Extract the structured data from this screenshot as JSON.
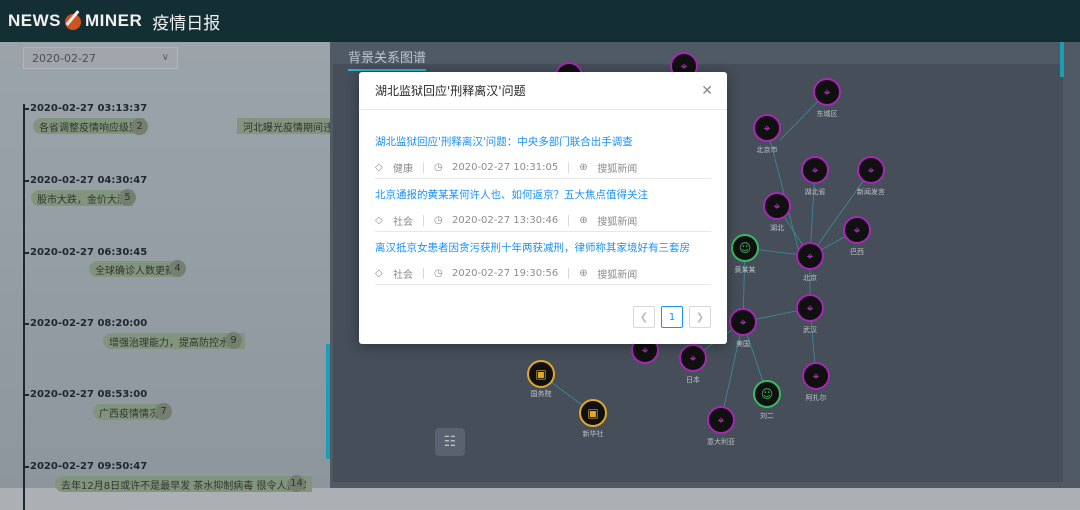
{
  "header": {
    "brand_left": "NEWS",
    "brand_right": "MINER",
    "app_title": "疫情日报"
  },
  "filter": {
    "date_value": "2020-02-27"
  },
  "graph": {
    "title": "背景关系图谱",
    "nodes": [
      {
        "label": "东城区",
        "type": "place"
      },
      {
        "label": "北京市",
        "type": "place"
      },
      {
        "label": "湖北省",
        "type": "place"
      },
      {
        "label": "新闻发言",
        "type": "place"
      },
      {
        "label": "湖北",
        "type": "place"
      },
      {
        "label": "巴西",
        "type": "place"
      },
      {
        "label": "黄某某",
        "type": "person"
      },
      {
        "label": "北京",
        "type": "place"
      },
      {
        "label": "武汉",
        "type": "place"
      },
      {
        "label": "美国",
        "type": "place"
      },
      {
        "label": "日本",
        "type": "place"
      },
      {
        "label": "刘二",
        "type": "person"
      },
      {
        "label": "阿扎尔",
        "type": "place"
      },
      {
        "label": "意大利亚",
        "type": "place"
      },
      {
        "label": "国务院",
        "type": "org"
      },
      {
        "label": "新华社",
        "type": "org"
      }
    ]
  },
  "timeline": [
    {
      "time": "2020-02-27 03:13:37",
      "tag": "各省调整疫情响应级别",
      "count": "2"
    },
    {
      "time": "2020-02-27 04:30:47",
      "tag": "股市大跌，金价大涨",
      "count": "5"
    },
    {
      "time": "2020-02-27 06:30:45",
      "tag": "全球确诊人数更新",
      "count": "4"
    },
    {
      "time": "2020-02-27 08:20:00",
      "tag": "增强治理能力，提高防控水平",
      "count": "9"
    },
    {
      "time": "2020-02-27 08:53:00",
      "tag": "广西疫情情况",
      "count": "7"
    },
    {
      "time": "2020-02-27 09:50:47",
      "tag": "去年12月8日或许不是最早发   茶水抑制病毒 很令人费解",
      "count": "14"
    }
  ],
  "timeline_extra_tag": "河北曝光疫情期间违法案件",
  "modal": {
    "title": "湖北监狱回应'刑释离汉'问题",
    "items": [
      {
        "title": "湖北监狱回应'刑释离汉'问题：中央多部门联合出手调查",
        "category": "健康",
        "datetime": "2020-02-27 10:31:05",
        "source": "搜狐新闻"
      },
      {
        "title": "北京通报的黄某某何许人也、如何返京？五大焦点值得关注",
        "category": "社会",
        "datetime": "2020-02-27 13:30:46",
        "source": "搜狐新闻"
      },
      {
        "title": "离汉抵京女患者因贪污获刑十年两获减刑，律师称其家境好有三套房",
        "category": "社会",
        "datetime": "2020-02-27 19:30:56",
        "source": "搜狐新闻"
      }
    ],
    "page": "1"
  }
}
